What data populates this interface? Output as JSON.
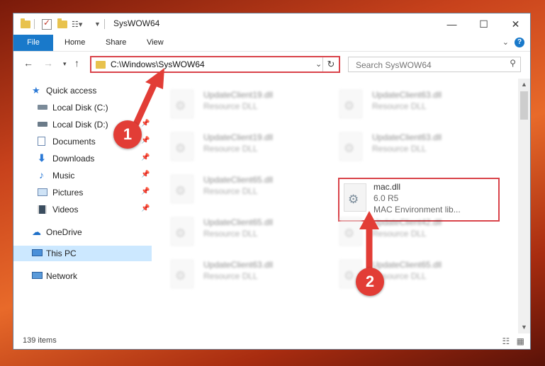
{
  "window": {
    "title": "SysWOW64",
    "controls": {
      "minimize": "—",
      "maximize": "☐",
      "close": "✕"
    }
  },
  "ribbon": {
    "tabs": [
      "File",
      "Home",
      "Share",
      "View"
    ],
    "help": "?"
  },
  "address": {
    "path": "C:\\Windows\\SysWOW64",
    "search_placeholder": "Search SysWOW64"
  },
  "nav_pane": {
    "items": [
      {
        "label": "Quick access",
        "icon": "star-icon",
        "pinned": false
      },
      {
        "label": "Local Disk (C:)",
        "icon": "drive-icon",
        "pinned": false
      },
      {
        "label": "Local Disk (D:)",
        "icon": "drive-icon",
        "pinned": true
      },
      {
        "label": "Documents",
        "icon": "documents-icon",
        "pinned": true
      },
      {
        "label": "Downloads",
        "icon": "download-icon",
        "pinned": true
      },
      {
        "label": "Music",
        "icon": "music-icon",
        "pinned": true
      },
      {
        "label": "Pictures",
        "icon": "pictures-icon",
        "pinned": true
      },
      {
        "label": "Videos",
        "icon": "videos-icon",
        "pinned": true
      },
      {
        "label": "OneDrive",
        "icon": "cloud-icon",
        "pinned": false
      },
      {
        "label": "This PC",
        "icon": "computer-icon",
        "pinned": false,
        "selected": true
      },
      {
        "label": "Network",
        "icon": "network-icon",
        "pinned": false
      }
    ]
  },
  "files": {
    "left_column": [
      {
        "name": "UpdateClient19.dll",
        "desc": "Resource DLL"
      },
      {
        "name": "UpdateClient19.dll",
        "desc": "Resource DLL"
      },
      {
        "name": "UpdateClient65.dll",
        "desc": "Resource DLL"
      },
      {
        "name": "UpdateClient65.dll",
        "desc": "Resource DLL"
      },
      {
        "name": "UpdateClient63.dll",
        "desc": "Resource DLL"
      }
    ],
    "right_column": [
      {
        "name": "UpdateClient63.dll",
        "desc": "Resource DLL"
      },
      {
        "name": "UpdateClient63.dll",
        "desc": "Resource DLL"
      },
      {
        "name": "mac.dll",
        "desc": "6.0 R5",
        "desc2": "MAC Environment lib...",
        "highlighted": true
      },
      {
        "name": "UpdateClient42.dll",
        "desc": "Resource DLL"
      },
      {
        "name": "UpdateClient65.dll",
        "desc": "Resource DLL"
      }
    ]
  },
  "status": {
    "item_count": "139 items"
  },
  "callouts": [
    "1",
    "2"
  ],
  "colors": {
    "accent": "#1979ca",
    "highlight": "#d9434a",
    "callout": "#e23d36"
  }
}
